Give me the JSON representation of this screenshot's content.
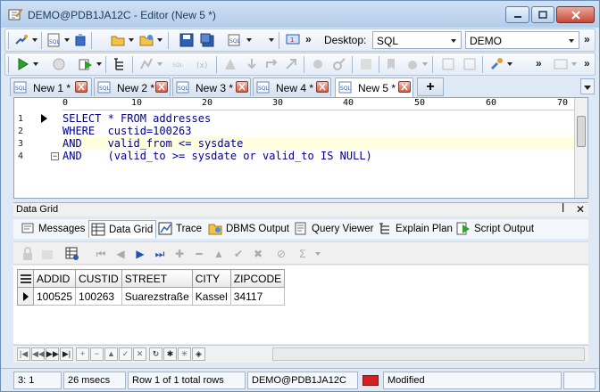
{
  "window": {
    "title": "DEMO@PDB1JA12C - Editor (New 5 *)",
    "colors": {
      "title_bg": "#c7dbf2",
      "close_btn": "#c64934",
      "keyword": "#00008b"
    }
  },
  "toolbar": {
    "desktop_label": "Desktop:",
    "desktop_value": "SQL",
    "connection_value": "DEMO",
    "more": "»"
  },
  "tabs": [
    {
      "label": "New 1 *",
      "active": false
    },
    {
      "label": "New 2 *",
      "active": false
    },
    {
      "label": "New 3 *",
      "active": false
    },
    {
      "label": "New 4 *",
      "active": false
    },
    {
      "label": "New 5 *",
      "active": true
    }
  ],
  "tab_add": "+",
  "editor": {
    "ruler": [
      "0",
      "10",
      "20",
      "30",
      "40",
      "50",
      "60",
      "70"
    ],
    "lines": [
      {
        "num": "1",
        "text": "SELECT * FROM addresses"
      },
      {
        "num": "2",
        "text": "WHERE  custid=100263"
      },
      {
        "num": "3",
        "text": "AND    valid_from <= sysdate"
      },
      {
        "num": "4",
        "text": "AND    (valid_to >= sysdate or valid_to IS NULL)"
      }
    ],
    "current_line": 3
  },
  "data_grid_panel": {
    "title": "Data Grid",
    "pin": "ꟾ",
    "close": "✕",
    "tabs": [
      "Messages",
      "Data Grid",
      "Trace",
      "DBMS Output",
      "Query Viewer",
      "Explain Plan",
      "Script Output"
    ],
    "active_tab": "Data Grid"
  },
  "grid": {
    "columns": [
      "ADDID",
      "CUSTID",
      "STREET",
      "CITY",
      "ZIPCODE"
    ],
    "rows": [
      [
        "100525",
        "100263",
        "Suarezstraße",
        "Kassel",
        "34117"
      ]
    ]
  },
  "status": {
    "position": "3:   1",
    "time": "26 msecs",
    "rows": "Row 1 of 1 total rows",
    "connection": "DEMO@PDB1JA12C",
    "state": "Modified"
  }
}
